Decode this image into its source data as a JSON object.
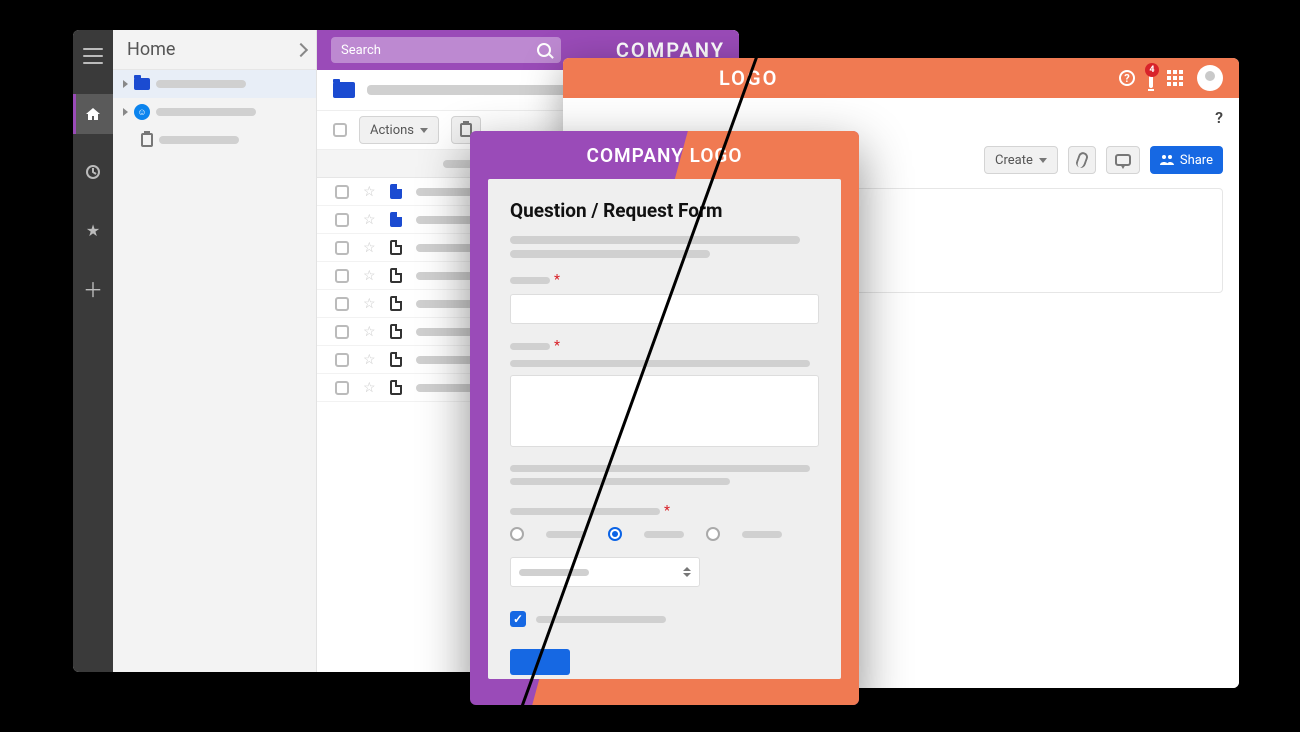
{
  "left_app": {
    "sidebar_title": "Home",
    "search_placeholder": "Search",
    "brand": "COMPANY",
    "actions_label": "Actions",
    "row_count": 8
  },
  "right_app": {
    "brand": "LOGO",
    "notification_count": "4",
    "help_label": "?",
    "create_label": "Create",
    "share_label": "Share"
  },
  "form": {
    "brand": "COMPANY LOGO",
    "title": "Question / Request Form",
    "required_marker": "*"
  }
}
